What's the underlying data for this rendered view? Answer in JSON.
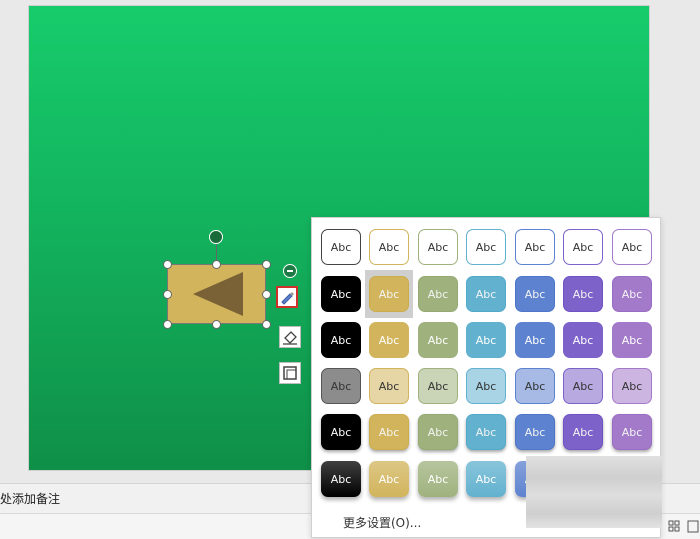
{
  "notes": {
    "text": "处添加备注"
  },
  "popup": {
    "more_settings": "更多设置(O)...",
    "cell_text": "Abc",
    "palette": [
      "#000000",
      "#d1b45c",
      "#9fb27e",
      "#62b1cf",
      "#5d82cf",
      "#7d62c9",
      "#a27ac9"
    ],
    "selected": {
      "row": 1,
      "col": 1
    }
  },
  "shape": {
    "fill": "#d1b45c",
    "arrow_fill": "#7a6136"
  },
  "slide": {
    "top_color": "#17cc6b",
    "bottom_color": "#0f8f48"
  }
}
